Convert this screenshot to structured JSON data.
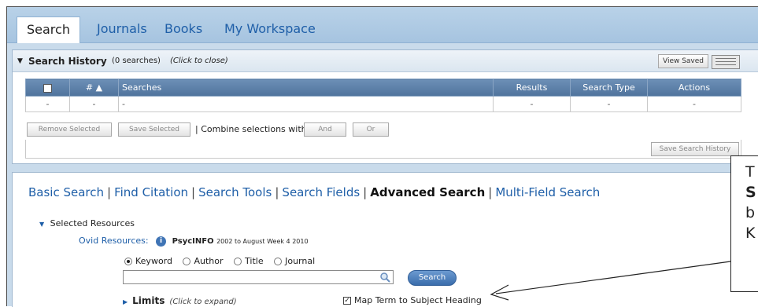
{
  "tabs": [
    {
      "label": "Search",
      "active": true
    },
    {
      "label": "Journals",
      "active": false
    },
    {
      "label": "Books",
      "active": false
    },
    {
      "label": "My Workspace",
      "active": false
    }
  ],
  "history": {
    "title": "Search History",
    "count": "(0 searches)",
    "toggle_hint": "(Click to close)",
    "view_saved": "View Saved",
    "columns": [
      "#",
      "Searches",
      "Results",
      "Search Type",
      "Actions"
    ],
    "sort_marker": "▲",
    "row": [
      "-",
      "-",
      "-",
      "-",
      "-",
      "-"
    ],
    "remove_selected": "Remove Selected",
    "save_selected": "Save Selected",
    "combine_label": "| Combine selections with:",
    "and_label": "And",
    "or_label": "Or",
    "save_history": "Save Search History"
  },
  "modes": {
    "basic": "Basic Search",
    "citation": "Find Citation",
    "tools": "Search Tools",
    "fields": "Search Fields",
    "advanced": "Advanced Search",
    "multi": "Multi-Field Search"
  },
  "resources": {
    "heading": "Selected Resources",
    "ovid_label": "Ovid Resources:",
    "database": "PsycINFO",
    "years": "2002 to August Week 4 2010"
  },
  "fields": {
    "keyword": "Keyword",
    "author": "Author",
    "title": "Title",
    "journal": "Journal",
    "selected": "keyword",
    "query": "",
    "search_button": "Search"
  },
  "limits": {
    "label": "Limits",
    "hint": "(Click to expand)",
    "map_term": "Map Term to Subject Heading",
    "map_checked": true
  },
  "callout": {
    "line1": "T",
    "line2": "S",
    "line3": "b",
    "line4": "K"
  }
}
